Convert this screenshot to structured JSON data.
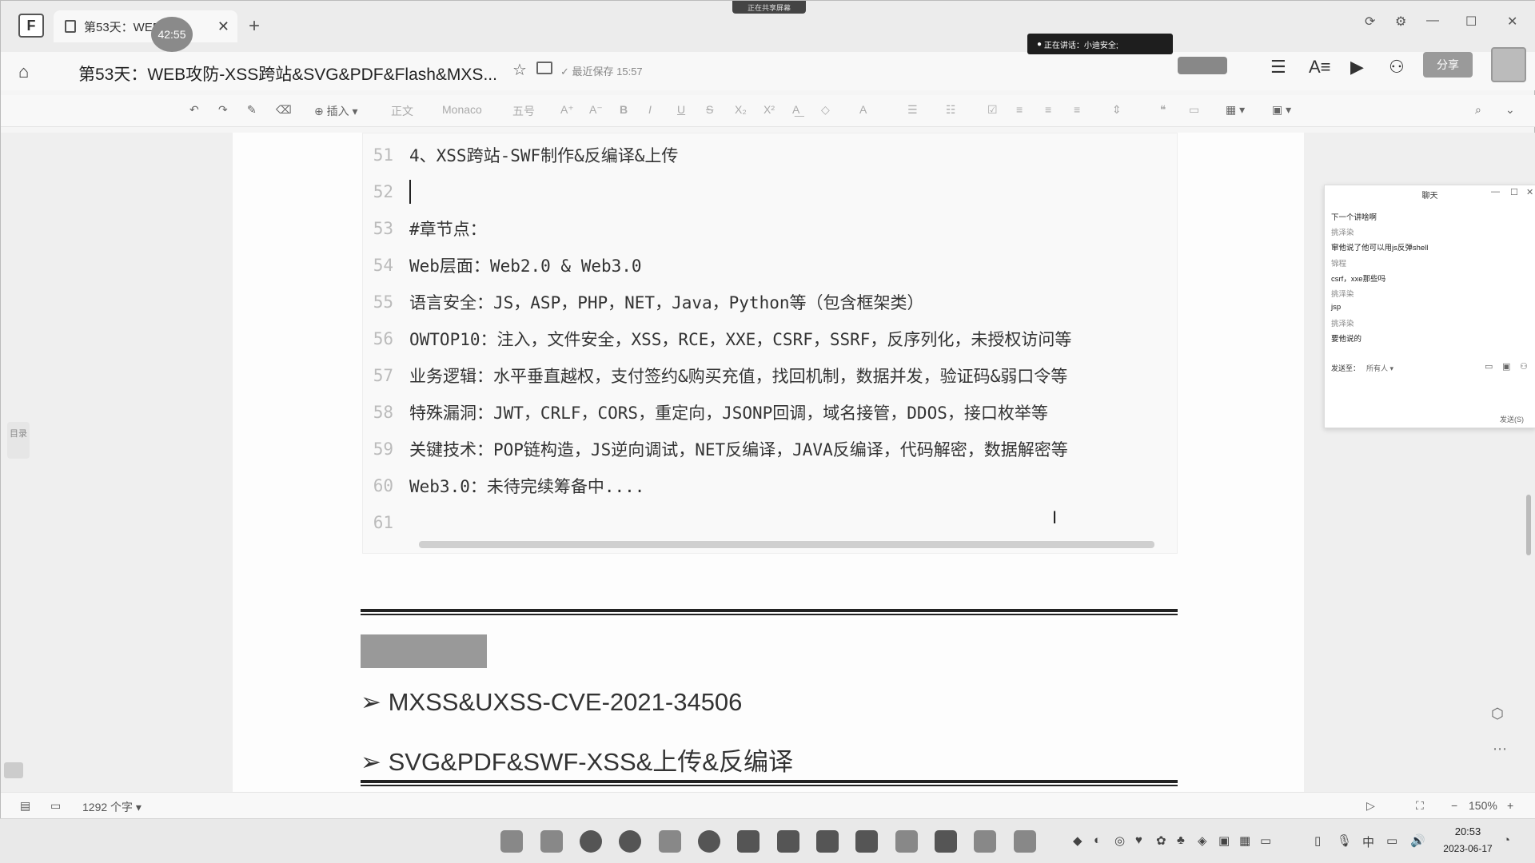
{
  "tabbar": {
    "tab_title": "第53天：WEF     S...",
    "timer": "42:55",
    "share_banner": "正在共享屏幕"
  },
  "titlerow": {
    "doc_title": "第53天：WEB攻防-XSS跨站&SVG&PDF&Flash&MXS...",
    "save_status": "最近保存 15:57",
    "speaking": "正在讲话：小迪安全;",
    "share_label": "分享"
  },
  "toolbar": {
    "insert": "插入",
    "style": "正文",
    "font": "Monaco",
    "size": "五号"
  },
  "code": {
    "lines": [
      {
        "n": "51",
        "text": "4、XSS跨站-SWF制作&反编译&上传"
      },
      {
        "n": "52",
        "text": ""
      },
      {
        "n": "53",
        "text": "#章节点："
      },
      {
        "n": "54",
        "text": "Web层面：Web2.0 & Web3.0"
      },
      {
        "n": "55",
        "text": "语言安全：JS，ASP，PHP，NET，Java，Python等（包含框架类）"
      },
      {
        "n": "56",
        "text": "OWTOP10：注入，文件安全，XSS，RCE，XXE，CSRF，SSRF，反序列化，未授权访问等"
      },
      {
        "n": "57",
        "text": "业务逻辑：水平垂直越权，支付签约&购买充值，找回机制，数据并发，验证码&弱口令等"
      },
      {
        "n": "58",
        "text": "特殊漏洞：JWT，CRLF，CORS，重定向，JSONP回调，域名接管，DDOS，接口枚举等"
      },
      {
        "n": "59",
        "text": "关键技术：POP链构造，JS逆向调试，NET反编译，JAVA反编译，代码解密，数据解密等"
      },
      {
        "n": "60",
        "text": "Web3.0：未待完续筹备中...."
      },
      {
        "n": "61",
        "text": ""
      }
    ]
  },
  "doc": {
    "bullet1": "➢ MXSS&UXSS-CVE-2021-34506",
    "bullet2": "➢ SVG&PDF&SWF-XSS&上传&反编译"
  },
  "chat": {
    "title": "聊天",
    "messages": [
      {
        "text": "下一个讲啥啊",
        "sender": false
      },
      {
        "text": "挑泽染",
        "sender": true
      },
      {
        "text": "窜他说了他可以用js反弹shell",
        "sender": false
      },
      {
        "text": "锦程",
        "sender": true
      },
      {
        "text": "csrf，xxe那些吗",
        "sender": false
      },
      {
        "text": "挑泽染",
        "sender": true
      },
      {
        "text": "jsp",
        "sender": false
      },
      {
        "text": "挑泽染",
        "sender": true
      },
      {
        "text": "要他说的",
        "sender": false
      }
    ],
    "send_to_label": "发送至：",
    "send_to_target": "所有人",
    "send_button": "发送(S)"
  },
  "side": {
    "toc": "目录"
  },
  "statusbar": {
    "word_count": "1292 个字",
    "zoom": "150%"
  },
  "taskbar": {
    "time": "20:53",
    "date": "2023-06-17",
    "ime": "中"
  }
}
